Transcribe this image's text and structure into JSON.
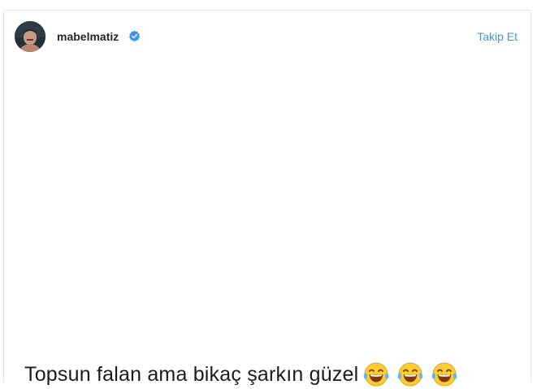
{
  "post": {
    "username": "mabelmatiz",
    "follow_label": "Takip Et",
    "caption": "Topsun falan ama bikaç şarkın güzel",
    "emojis": [
      "face-with-tears-of-joy",
      "face-with-tears-of-joy",
      "face-with-tears-of-joy"
    ]
  },
  "colors": {
    "accent": "#3897f0",
    "text": "#262626",
    "border": "#e6e6e6",
    "emoji_yellow": "#ffcc33"
  },
  "icons": {
    "verified": "verified-badge-icon",
    "avatar": "profile-avatar"
  }
}
